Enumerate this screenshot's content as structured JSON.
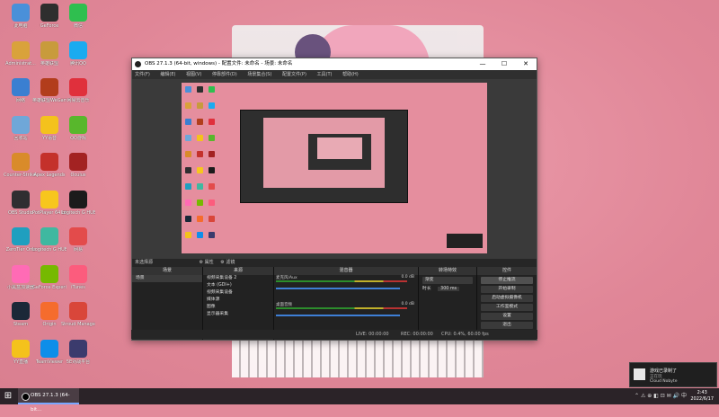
{
  "desktop": {
    "icons": [
      {
        "label": "此电脑",
        "color": "#4a90d9"
      },
      {
        "label": "GeForce",
        "color": "#2e2e2e"
      },
      {
        "label": "微信",
        "color": "#2fbf4f"
      },
      {
        "label": "Administrat...",
        "color": "#d9a23b"
      },
      {
        "label": "英雄联盟",
        "color": "#c89b3c"
      },
      {
        "label": "腾讯QQ",
        "color": "#1aabf0"
      },
      {
        "label": "网络",
        "color": "#3a7fd1"
      },
      {
        "label": "英雄联盟WeGame版",
        "color": "#b23d1c"
      },
      {
        "label": "网易云音乐",
        "color": "#e0303c"
      },
      {
        "label": "回收站",
        "color": "#6fa7d8"
      },
      {
        "label": "YY语音",
        "color": "#f4c21c"
      },
      {
        "label": "QQ游戏",
        "color": "#58b72c"
      },
      {
        "label": "Counter-Strike Global Off...",
        "color": "#d98b2a"
      },
      {
        "label": "Apex Legends",
        "color": "#c4312b"
      },
      {
        "label": "Oculus",
        "color": "#a32222"
      },
      {
        "label": "OBS Studio",
        "color": "#302e31"
      },
      {
        "label": "PotPlayer 64 bit",
        "color": "#f7c61d"
      },
      {
        "label": "Logitech G HUB",
        "color": "#1b1b1b"
      },
      {
        "label": "ZeroTier One",
        "color": "#1f9fbf"
      },
      {
        "label": "Logitech G HUB 2",
        "color": "#3fb8a0"
      },
      {
        "label": "网易",
        "color": "#e34b4b"
      },
      {
        "label": "小黑盒加速器",
        "color": "#ff6bb5"
      },
      {
        "label": "GeForce Experience",
        "color": "#76b900"
      },
      {
        "label": "iTunes",
        "color": "#fc5c7d"
      },
      {
        "label": "Steam",
        "color": "#1b2838"
      },
      {
        "label": "Origin",
        "color": "#f56c2d"
      },
      {
        "label": "Stroud Manager",
        "color": "#d9463a"
      },
      {
        "label": "YY直播",
        "color": "#f4c21c"
      },
      {
        "label": "TeamViewer",
        "color": "#0e8ee9"
      },
      {
        "label": "5E对战平台",
        "color": "#3b3b6d"
      }
    ]
  },
  "obs": {
    "title": "OBS 27.1.3 (64-bit, windows) - 配置文件: 未命名 - 场景: 未命名",
    "menu": [
      "文件(F)",
      "编辑(E)",
      "视图(V)",
      "停靠部件(D)",
      "场景集合(S)",
      "配置文件(P)",
      "工具(T)",
      "帮助(H)"
    ],
    "controls": {
      "min": "—",
      "max": "☐",
      "close": "✕"
    },
    "scene_bar": "未选择源",
    "scene_toolbar": [
      "⚙ 属性",
      "⚙ 滤镜"
    ],
    "docks": {
      "scenes": {
        "title": "场景",
        "items": [
          "场景"
        ]
      },
      "sources": {
        "title": "来源",
        "items": [
          "视频采集设备 2",
          "文本 (GDI+)",
          "视频采集设备",
          "媒体源",
          "图像",
          "显示器采集"
        ]
      },
      "mixer": {
        "title": "混音器",
        "channels": [
          {
            "name": "麦克风/Aux",
            "value": "0.0 dB"
          },
          {
            "name": "桌面音频",
            "value": "0.0 dB"
          }
        ]
      },
      "transitions": {
        "title": "转场特效",
        "mode": "渐变",
        "duration_label": "时长",
        "duration": "300 ms"
      },
      "controls": {
        "title": "控件",
        "buttons": [
          "停止推流",
          "开始录制",
          "启动虚拟摄像机",
          "工作室模式",
          "设置",
          "退出"
        ]
      }
    },
    "footer_icons": "+ − ∧ ∨",
    "status": {
      "live": "LIVE: 00:00:00",
      "rec": "REC: 00:00:00",
      "cpu": "CPU: 0.4%, 60.00 fps"
    }
  },
  "taskbar": {
    "start_label": "⊞",
    "task_obs": "OBS 27.1.3 (64-bit...",
    "tray": "⌃  ⚠  ⊕  ◧  ⊡  ✉  🔊  中",
    "time": "2:43",
    "date": "2022/6/17"
  },
  "toast": {
    "title": "游戏已录制了",
    "sub": "正在玩",
    "app": "Cloud Nobyte"
  }
}
